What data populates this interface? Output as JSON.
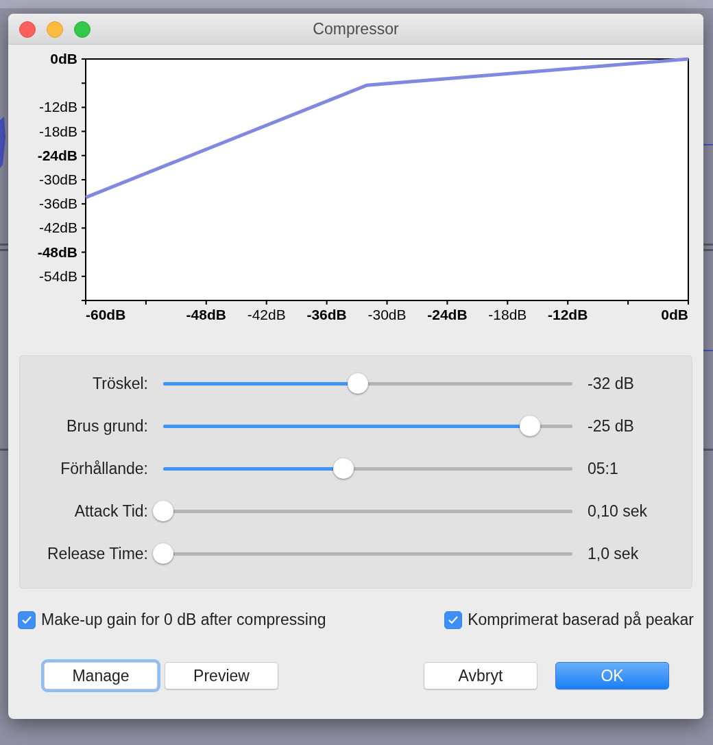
{
  "window": {
    "title": "Compressor"
  },
  "graph": {
    "chart_data": {
      "type": "line",
      "xlim": [
        -60,
        0
      ],
      "ylim": [
        -60,
        0
      ],
      "x": [
        -60,
        -32,
        0
      ],
      "series": [
        {
          "color": "#8088e0",
          "values": [
            -34.4,
            -6.5,
            0
          ]
        }
      ],
      "xticks": [
        {
          "value": -60,
          "label": "**-60dB**"
        },
        {
          "value": -48,
          "label": "**-48dB**"
        },
        {
          "value": -42,
          "label": "-42dB"
        },
        {
          "value": -36,
          "label": "**-36dB**"
        },
        {
          "value": -30,
          "label": "-30dB"
        },
        {
          "value": -24,
          "label": "**-24dB**"
        },
        {
          "value": -18,
          "label": "-18dB"
        },
        {
          "value": -12,
          "label": "**-12dB**"
        },
        {
          "value": 0,
          "label": "**0dB**"
        }
      ],
      "yticks": [
        {
          "value": 0,
          "label": "**0dB**"
        },
        {
          "value": -12,
          "label": "-12dB"
        },
        {
          "value": -18,
          "label": "-18dB"
        },
        {
          "value": -24,
          "label": "**-24dB**"
        },
        {
          "value": -30,
          "label": "-30dB"
        },
        {
          "value": -36,
          "label": "-36dB"
        },
        {
          "value": -42,
          "label": "-42dB"
        },
        {
          "value": -48,
          "label": "**-48dB**"
        },
        {
          "value": -54,
          "label": "-54dB"
        }
      ]
    }
  },
  "sliders": [
    {
      "label": "Tröskel:",
      "level": 0.476,
      "reading": "-32 dB"
    },
    {
      "label": "Brus grund:",
      "level": 0.896,
      "reading": "-25 dB"
    },
    {
      "label": "Förhållande:",
      "level": 0.44,
      "reading": "05:1"
    },
    {
      "label": "Attack Tid:",
      "level": 0,
      "reading": "0,10 sek"
    },
    {
      "label": "Release Time:",
      "level": 0,
      "reading": "1,0 sek"
    }
  ],
  "checkboxes": [
    {
      "label": "Make-up gain for 0 dB after compressing",
      "checked": true
    },
    {
      "label": "Komprimerat baserad på peakar",
      "checked": true
    }
  ],
  "buttons_left": [
    {
      "label": "Manage",
      "focused": true,
      "default": false
    },
    {
      "label": "Preview",
      "focused": false,
      "default": false
    }
  ],
  "buttons_right": [
    {
      "label": "Avbryt",
      "focused": false,
      "default": false
    },
    {
      "label": "OK",
      "focused": false,
      "default": true
    }
  ]
}
